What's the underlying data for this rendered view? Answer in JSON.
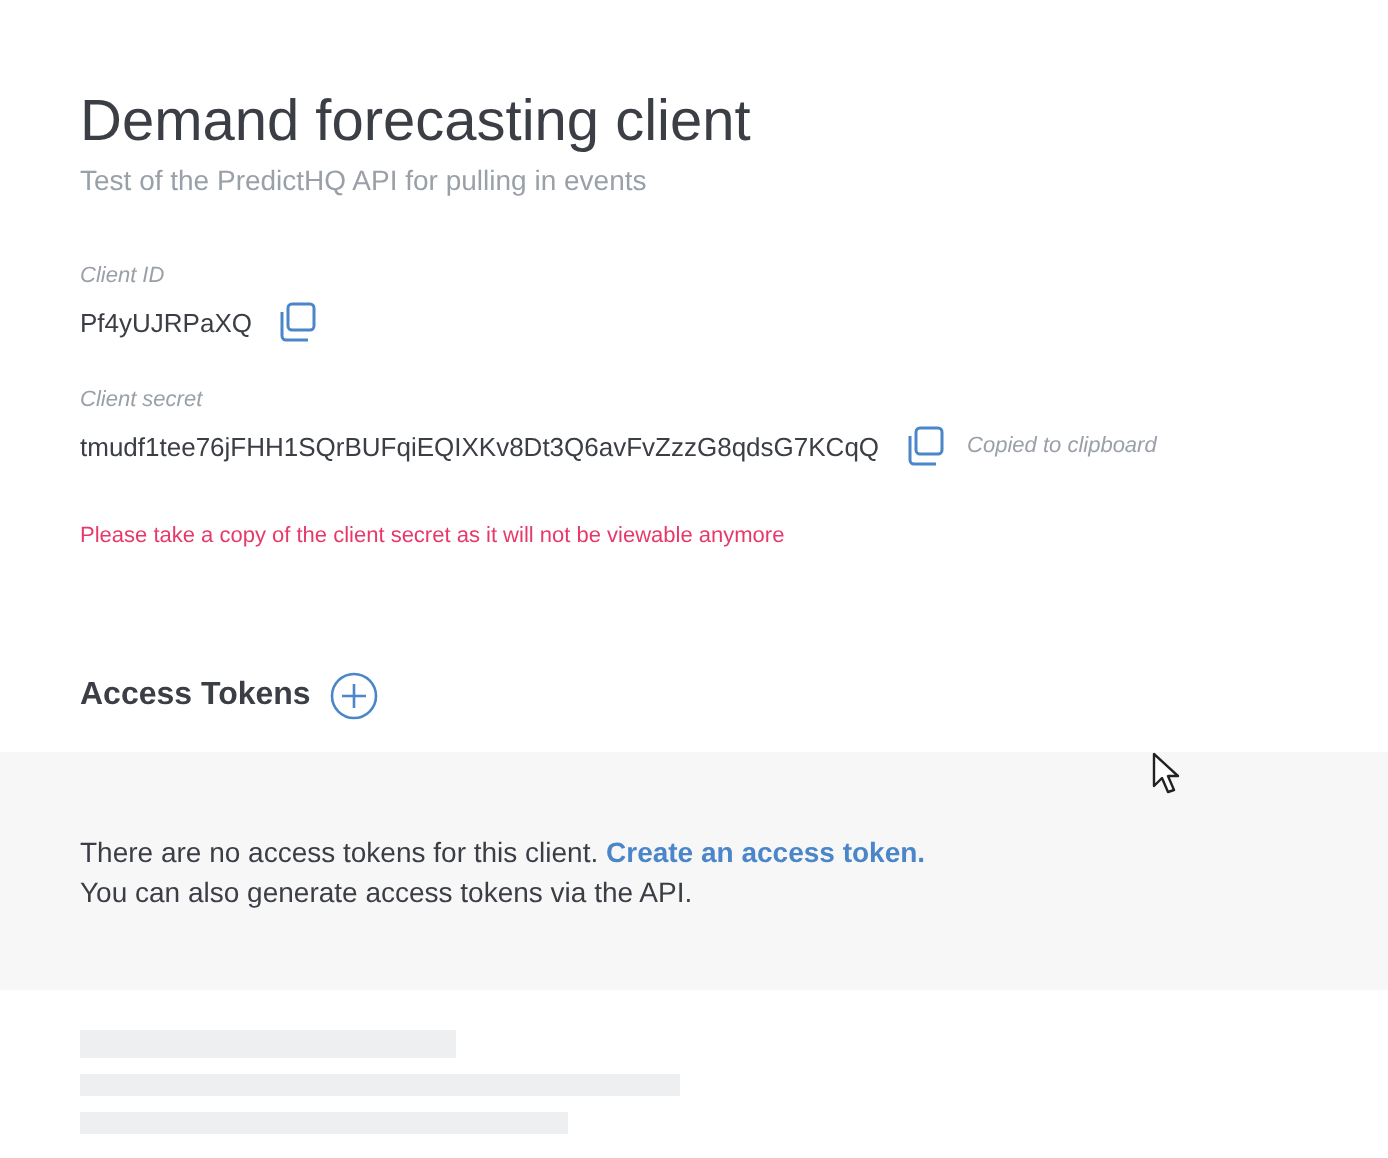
{
  "title": "Demand forecasting client",
  "subtitle": "Test of the PredictHQ API for pulling in events",
  "fields": [
    {
      "label": "Client ID",
      "value": "Pf4yUJRPaXQ"
    },
    {
      "label": "Client secret",
      "value": "tmudf1tee76jFHH1SQrBUFqiEQIXKv8Dt3Q6avFvZzzG8qdsG7KCqQ",
      "copied_note": "Copied to clipboard"
    }
  ],
  "warning": "Please take a copy of the client secret as it will not be viewable anymore",
  "access_tokens": {
    "heading": "Access Tokens",
    "empty_text": "There are no access tokens for this client.",
    "create_link": "Create an access token.",
    "api_note": "You can also generate access tokens via the API."
  }
}
